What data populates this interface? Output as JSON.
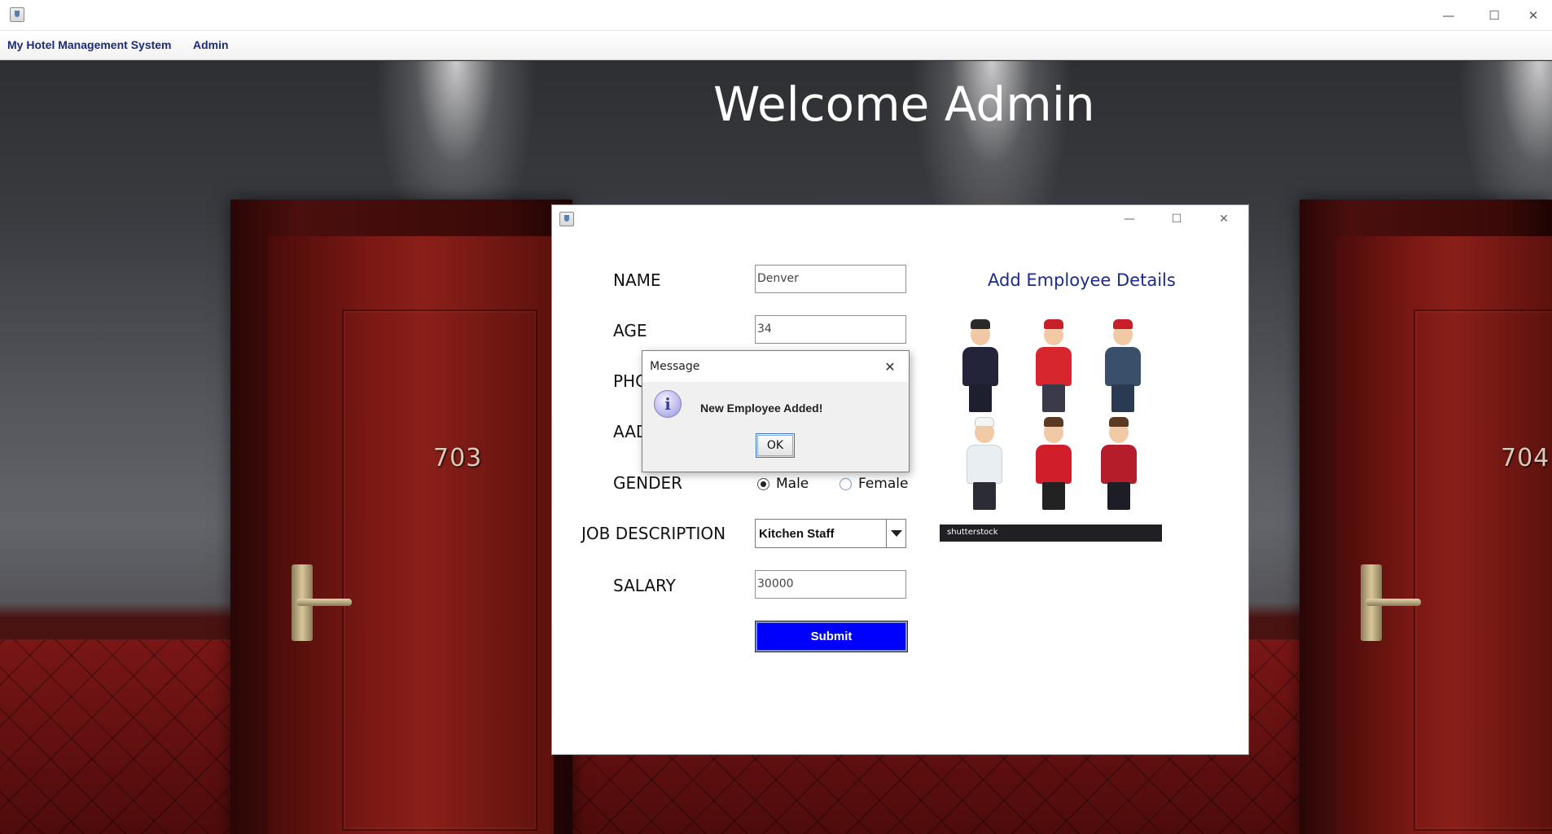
{
  "window": {
    "min_glyph": "—",
    "max_glyph": "☐",
    "close_glyph": "✕"
  },
  "menubar": {
    "items": [
      {
        "label": "My Hotel Management System"
      },
      {
        "label": "Admin"
      }
    ]
  },
  "background": {
    "welcome_title": "Welcome Admin",
    "door_numbers": [
      "703",
      "704"
    ]
  },
  "employee_form": {
    "heading": "Add Employee Details",
    "name": {
      "label": "NAME",
      "value": "Denver"
    },
    "age": {
      "label": "AGE",
      "value": "34"
    },
    "phone": {
      "label": "PHC"
    },
    "aadhar": {
      "label": "AAD"
    },
    "gender": {
      "label": "GENDER",
      "options": [
        "Male",
        "Female"
      ],
      "selected": "Male"
    },
    "job": {
      "label": "JOB DESCRIPTION",
      "value": "Kitchen Staff"
    },
    "salary": {
      "label": "SALARY",
      "value": "30000"
    },
    "submit_label": "Submit",
    "image_watermark": "shutterstock"
  },
  "message_dialog": {
    "title": "Message",
    "text": "New Employee Added!",
    "ok_label": "OK",
    "icon_glyph": "i",
    "close_glyph": "✕"
  },
  "colors": {
    "submit_bg": "#0000ff",
    "menu_text": "#1c2a7a",
    "heading_text": "#1c2a8a"
  }
}
